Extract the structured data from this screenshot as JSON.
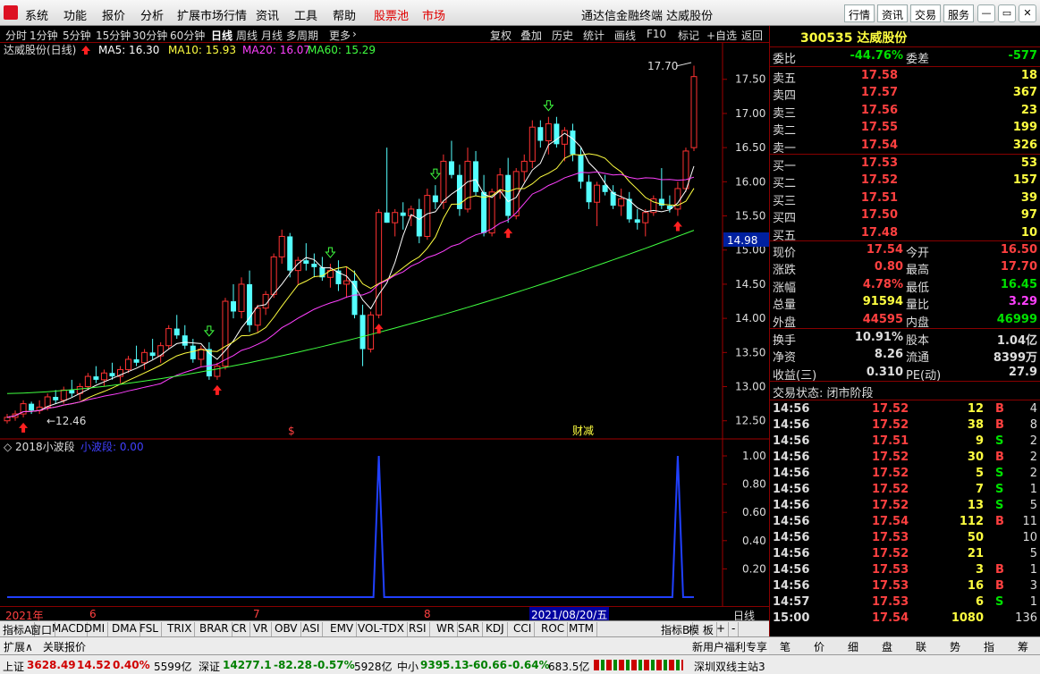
{
  "menu": {
    "items": [
      "系统",
      "功能",
      "报价",
      "分析",
      "扩展市场行情",
      "资讯",
      "工具",
      "帮助"
    ],
    "red_items": [
      "股票池",
      "市场"
    ],
    "title": "通达信金融终端  达威股份",
    "right_buttons": [
      "行情",
      "资讯",
      "交易",
      "服务"
    ]
  },
  "toolbar": {
    "periods": [
      "分时",
      "1分钟",
      "5分钟",
      "15分钟",
      "30分钟",
      "60分钟",
      "日线",
      "周线",
      "月线",
      "多周期",
      "更多"
    ],
    "selected": "日线",
    "more_arrow": "›",
    "actions": [
      "复权",
      "叠加",
      "历史",
      "统计",
      "画线",
      "F10",
      "标记",
      "+自选",
      "返回"
    ]
  },
  "chart": {
    "stock": "达威股份(日线)",
    "ma_labels": [
      {
        "text": "MA5: 16.30",
        "color": "#ffffff"
      },
      {
        "text": "MA10: 15.93",
        "color": "#ffff40"
      },
      {
        "text": "MA20: 16.07",
        "color": "#ff40ff"
      },
      {
        "text": "MA60: 15.29",
        "color": "#40ff40"
      }
    ],
    "yticks": [
      "17.50",
      "17.00",
      "16.50",
      "16.00",
      "15.50",
      "15.00",
      "14.50",
      "14.00",
      "13.50",
      "13.00",
      "12.50"
    ],
    "high_label": "17.70",
    "low_label": "12.46",
    "current_price": "14.98",
    "s_marker": "$",
    "event_marker": "财减",
    "indicator": {
      "name": "2018小波段",
      "sub": "小波段: 0.00",
      "yticks": [
        "1.00",
        "0.80",
        "0.60",
        "0.40",
        "0.20"
      ]
    }
  },
  "chart_data": {
    "type": "candlestick",
    "ylim": [
      12.3,
      17.85
    ],
    "ohlc": [
      [
        12.5,
        12.6,
        12.46,
        12.55
      ],
      [
        12.55,
        12.65,
        12.5,
        12.6
      ],
      [
        12.6,
        12.8,
        12.55,
        12.75
      ],
      [
        12.75,
        12.78,
        12.6,
        12.65
      ],
      [
        12.65,
        12.8,
        12.6,
        12.7
      ],
      [
        12.7,
        12.9,
        12.65,
        12.85
      ],
      [
        12.85,
        12.95,
        12.75,
        12.8
      ],
      [
        12.8,
        13.0,
        12.75,
        12.95
      ],
      [
        12.95,
        13.1,
        12.85,
        12.9
      ],
      [
        12.9,
        13.05,
        12.8,
        13.0
      ],
      [
        13.0,
        13.2,
        12.95,
        13.15
      ],
      [
        13.15,
        13.3,
        13.05,
        13.1
      ],
      [
        13.1,
        13.25,
        13.0,
        13.2
      ],
      [
        13.2,
        13.35,
        13.1,
        13.15
      ],
      [
        13.15,
        13.3,
        13.05,
        13.25
      ],
      [
        13.25,
        13.45,
        13.2,
        13.4
      ],
      [
        13.4,
        13.6,
        13.3,
        13.35
      ],
      [
        13.35,
        13.55,
        13.25,
        13.5
      ],
      [
        13.5,
        13.7,
        13.4,
        13.45
      ],
      [
        13.45,
        13.65,
        13.35,
        13.6
      ],
      [
        13.6,
        13.9,
        13.55,
        13.85
      ],
      [
        13.85,
        14.05,
        13.7,
        13.75
      ],
      [
        13.75,
        13.9,
        13.55,
        13.6
      ],
      [
        13.6,
        13.7,
        13.35,
        13.4
      ],
      [
        13.4,
        13.6,
        13.3,
        13.55
      ],
      [
        13.55,
        13.65,
        13.1,
        13.15
      ],
      [
        13.15,
        13.35,
        13.1,
        13.3
      ],
      [
        13.3,
        14.3,
        13.25,
        14.25
      ],
      [
        14.25,
        14.5,
        14.0,
        14.1
      ],
      [
        14.1,
        14.6,
        14.0,
        14.5
      ],
      [
        14.5,
        14.7,
        13.8,
        13.9
      ],
      [
        13.9,
        14.2,
        13.8,
        14.15
      ],
      [
        14.15,
        14.4,
        14.05,
        14.35
      ],
      [
        14.35,
        14.95,
        14.3,
        14.9
      ],
      [
        14.9,
        15.3,
        14.8,
        15.2
      ],
      [
        15.2,
        15.25,
        14.6,
        14.7
      ],
      [
        14.7,
        14.9,
        14.5,
        14.85
      ],
      [
        14.85,
        15.1,
        14.7,
        14.8
      ],
      [
        14.8,
        14.95,
        14.6,
        14.75
      ],
      [
        14.75,
        14.9,
        14.55,
        14.6
      ],
      [
        14.6,
        14.8,
        14.45,
        14.7
      ],
      [
        14.7,
        14.85,
        14.4,
        14.5
      ],
      [
        14.5,
        14.75,
        14.3,
        14.55
      ],
      [
        14.55,
        14.7,
        14.0,
        14.05
      ],
      [
        14.05,
        14.2,
        13.3,
        13.55
      ],
      [
        13.55,
        14.1,
        13.5,
        14.05
      ],
      [
        14.05,
        15.6,
        14.0,
        15.55
      ],
      [
        15.55,
        16.5,
        15.4,
        15.4
      ],
      [
        15.4,
        15.6,
        15.2,
        15.55
      ],
      [
        15.55,
        15.7,
        15.3,
        15.5
      ],
      [
        15.5,
        15.65,
        15.35,
        15.6
      ],
      [
        15.6,
        15.75,
        15.1,
        15.2
      ],
      [
        15.2,
        15.9,
        15.15,
        15.8
      ],
      [
        15.8,
        15.95,
        15.6,
        15.7
      ],
      [
        15.7,
        16.4,
        15.6,
        16.3
      ],
      [
        16.3,
        16.6,
        16.05,
        16.1
      ],
      [
        16.1,
        16.25,
        15.5,
        15.6
      ],
      [
        15.6,
        16.5,
        15.55,
        16.3
      ],
      [
        16.3,
        16.45,
        15.8,
        15.85
      ],
      [
        15.85,
        16.1,
        15.2,
        15.25
      ],
      [
        15.25,
        15.9,
        15.2,
        15.85
      ],
      [
        15.85,
        16.2,
        15.75,
        16.1
      ],
      [
        16.1,
        16.35,
        15.4,
        15.5
      ],
      [
        15.5,
        16.2,
        15.45,
        16.15
      ],
      [
        16.15,
        16.4,
        16.0,
        16.3
      ],
      [
        16.3,
        16.9,
        16.2,
        16.8
      ],
      [
        16.8,
        16.9,
        16.5,
        16.6
      ],
      [
        16.6,
        16.95,
        16.4,
        16.85
      ],
      [
        16.85,
        16.95,
        16.5,
        16.55
      ],
      [
        16.55,
        16.8,
        16.3,
        16.75
      ],
      [
        16.75,
        16.85,
        16.3,
        16.4
      ],
      [
        16.4,
        16.5,
        15.9,
        16.0
      ],
      [
        16.0,
        16.1,
        15.6,
        15.7
      ],
      [
        15.7,
        16.0,
        15.35,
        15.95
      ],
      [
        15.95,
        16.1,
        15.8,
        15.85
      ],
      [
        15.85,
        15.95,
        15.6,
        15.65
      ],
      [
        15.65,
        15.9,
        15.5,
        15.75
      ],
      [
        15.75,
        15.85,
        15.4,
        15.45
      ],
      [
        15.45,
        15.6,
        15.3,
        15.4
      ],
      [
        15.4,
        15.6,
        15.2,
        15.55
      ],
      [
        15.55,
        15.8,
        15.5,
        15.75
      ],
      [
        15.75,
        16.2,
        15.6,
        15.65
      ],
      [
        15.65,
        15.8,
        15.55,
        15.6
      ],
      [
        15.6,
        16.0,
        15.5,
        15.9
      ],
      [
        15.9,
        16.5,
        15.85,
        16.45
      ],
      [
        16.5,
        17.7,
        16.45,
        17.54
      ]
    ],
    "ma60": {
      "from": [
        12.9,
        13.3
      ],
      "to": [
        15.29
      ]
    },
    "indicator_peaks": [
      1.0,
      1.0
    ]
  },
  "quote": {
    "code_name": "300535 达威股份",
    "weibi": {
      "label": "委比",
      "value": "-44.76%",
      "label2": "委差",
      "value2": "-577"
    },
    "asks": [
      {
        "label": "卖五",
        "price": "17.58",
        "vol": "18"
      },
      {
        "label": "卖四",
        "price": "17.57",
        "vol": "367"
      },
      {
        "label": "卖三",
        "price": "17.56",
        "vol": "23"
      },
      {
        "label": "卖二",
        "price": "17.55",
        "vol": "199"
      },
      {
        "label": "卖一",
        "price": "17.54",
        "vol": "326"
      }
    ],
    "bids": [
      {
        "label": "买一",
        "price": "17.53",
        "vol": "53"
      },
      {
        "label": "买二",
        "price": "17.52",
        "vol": "157"
      },
      {
        "label": "买三",
        "price": "17.51",
        "vol": "39"
      },
      {
        "label": "买四",
        "price": "17.50",
        "vol": "97"
      },
      {
        "label": "买五",
        "price": "17.48",
        "vol": "10"
      }
    ],
    "stats": [
      [
        {
          "l": "现价",
          "v": "17.54",
          "c": "red"
        },
        {
          "l": "今开",
          "v": "16.50",
          "c": "red"
        }
      ],
      [
        {
          "l": "涨跌",
          "v": "0.80",
          "c": "red"
        },
        {
          "l": "最高",
          "v": "17.70",
          "c": "red"
        }
      ],
      [
        {
          "l": "涨幅",
          "v": "4.78%",
          "c": "red"
        },
        {
          "l": "最低",
          "v": "16.45",
          "c": "grn"
        }
      ],
      [
        {
          "l": "总量",
          "v": "91594",
          "c": "yel"
        },
        {
          "l": "量比",
          "v": "3.29",
          "c": "mag"
        }
      ],
      [
        {
          "l": "外盘",
          "v": "44595",
          "c": "red"
        },
        {
          "l": "内盘",
          "v": "46999",
          "c": "grn"
        }
      ]
    ],
    "stats2": [
      [
        {
          "l": "换手",
          "v": "10.91%"
        },
        {
          "l": "股本",
          "v": "1.04亿"
        }
      ],
      [
        {
          "l": "净资",
          "v": "8.26"
        },
        {
          "l": "流通",
          "v": "8399万"
        }
      ],
      [
        {
          "l": "收益(三)",
          "v": "0.310"
        },
        {
          "l": "PE(动)",
          "v": "27.9"
        }
      ]
    ],
    "trade_state": "交易状态: 闭市阶段",
    "ticks": [
      [
        "14:56",
        "17.52",
        "12",
        "B",
        "4"
      ],
      [
        "14:56",
        "17.52",
        "38",
        "B",
        "8"
      ],
      [
        "14:56",
        "17.51",
        "9",
        "S",
        "2"
      ],
      [
        "14:56",
        "17.52",
        "30",
        "B",
        "2"
      ],
      [
        "14:56",
        "17.52",
        "5",
        "S",
        "2"
      ],
      [
        "14:56",
        "17.52",
        "7",
        "S",
        "1"
      ],
      [
        "14:56",
        "17.52",
        "13",
        "S",
        "5"
      ],
      [
        "14:56",
        "17.54",
        "112",
        "B",
        "11"
      ],
      [
        "14:56",
        "17.53",
        "50",
        "",
        "10"
      ],
      [
        "14:56",
        "17.52",
        "21",
        "",
        "5"
      ],
      [
        "14:56",
        "17.53",
        "3",
        "B",
        "1"
      ],
      [
        "14:56",
        "17.53",
        "16",
        "B",
        "3"
      ],
      [
        "14:57",
        "17.53",
        "6",
        "S",
        "1"
      ],
      [
        "15:00",
        "17.54",
        "1080",
        "",
        "136"
      ]
    ]
  },
  "axis_bottom": {
    "labels": [
      "2021年",
      "6",
      "7",
      "8",
      "2021/08/20/五"
    ],
    "mode": "日线"
  },
  "indicator_tabs": [
    "指标A",
    "窗口",
    "MACD",
    "DMI",
    "DMA",
    "FSL",
    "TRIX",
    "BRAR",
    "CR",
    "VR",
    "OBV",
    "ASI",
    "EMV",
    "VOL-TDX",
    "RSI",
    "WR",
    "SAR",
    "KDJ",
    "CCI",
    "ROC",
    "MTM",
    "指标B",
    "模 板",
    "+",
    "-"
  ],
  "ext_tabs": [
    "扩展∧",
    "关联报价"
  ],
  "ext_right": "新用户福利专享",
  "right_tabs": [
    "笔",
    "价",
    "细",
    "盘",
    "联",
    "势",
    "指",
    "筹"
  ],
  "status": {
    "sh_label": "上证",
    "sh": "3628.49",
    "sh_chg": "14.52",
    "sh_pct": "0.40%",
    "sh_amt": "5599亿",
    "sz_label": "深证",
    "sz": "14277.1",
    "sz_chg": "-82.28",
    "sz_pct": "-0.57%",
    "sz_amt": "5928亿",
    "zx_label": "中小",
    "zx": "9395.13",
    "zx_chg": "-60.66",
    "zx_pct": "-0.64%",
    "zx_amt": "683.5亿",
    "server": "深圳双线主站3"
  }
}
